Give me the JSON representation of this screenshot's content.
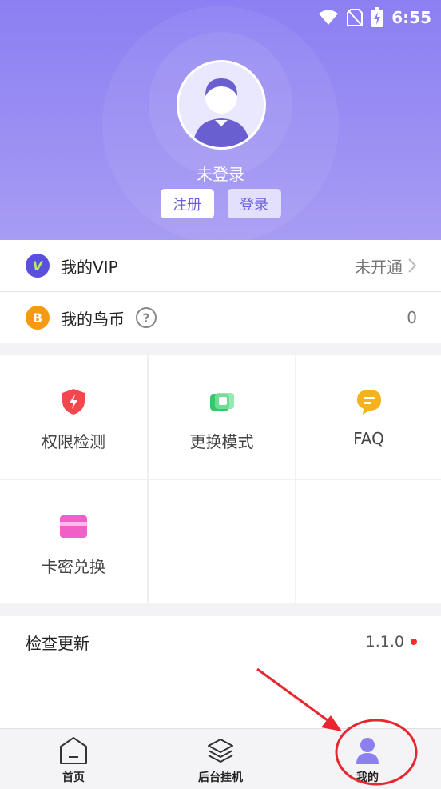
{
  "status_bar": {
    "time": "6:55",
    "icons": [
      "wifi-icon",
      "no-sim-icon",
      "battery-charging-icon"
    ]
  },
  "profile": {
    "username": "未登录",
    "register_label": "注册",
    "login_label": "登录"
  },
  "vip_row": {
    "badge": "V",
    "label": "我的VIP",
    "value": "未开通"
  },
  "coin_row": {
    "badge": "B",
    "label": "我的鸟币",
    "help": "?",
    "value": "0"
  },
  "features": [
    {
      "label": "权限检测",
      "icon": "shield-icon"
    },
    {
      "label": "更换模式",
      "icon": "switch-icon"
    },
    {
      "label": "FAQ",
      "icon": "chat-bubble-icon"
    },
    {
      "label": "卡密兑换",
      "icon": "card-icon"
    }
  ],
  "update_row": {
    "label": "检查更新",
    "version": "1.1.0"
  },
  "tabs": [
    {
      "label": "首页",
      "icon": "home-icon"
    },
    {
      "label": "后台挂机",
      "icon": "layers-icon"
    },
    {
      "label": "我的",
      "icon": "profile-icon"
    }
  ],
  "colors": {
    "header": "#8b7ff3",
    "accent": "#6a5fe0",
    "annotation": "#e8262e",
    "vip": "#5b4fe0",
    "coin": "#f59a12"
  }
}
